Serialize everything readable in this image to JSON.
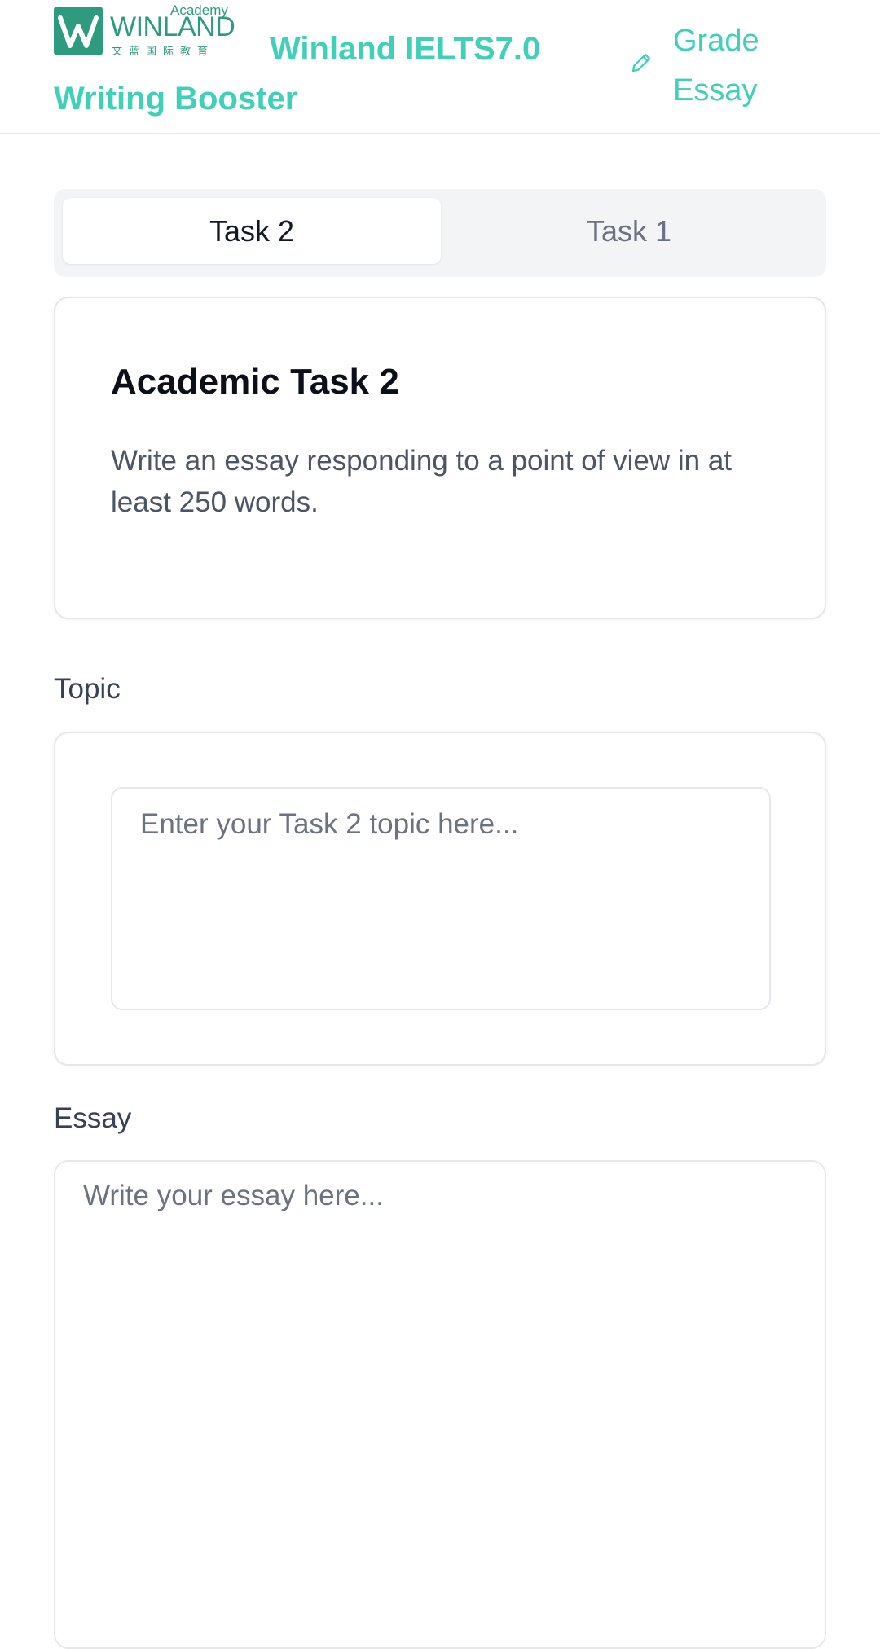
{
  "header": {
    "logo": {
      "small_text": "Academy",
      "wordmark": "WINLAND",
      "chinese": "文蓝国际教育",
      "brand_color": "#2e9a7e"
    },
    "app_title": "Winland IELTS7.0 Writing Booster",
    "grade_link": {
      "label": "Grade Essay",
      "icon": "pencil-icon"
    },
    "accent_color": "#40d0b8"
  },
  "tabs": [
    {
      "label": "Task 2",
      "active": true
    },
    {
      "label": "Task 1",
      "active": false
    }
  ],
  "task_card": {
    "title": "Academic Task 2",
    "description": "Write an essay responding to a point of view in at least 250 words."
  },
  "topic": {
    "label": "Topic",
    "value": "",
    "placeholder": "Enter your Task 2 topic here..."
  },
  "essay": {
    "label": "Essay",
    "value": "",
    "placeholder": "Write your essay here..."
  }
}
